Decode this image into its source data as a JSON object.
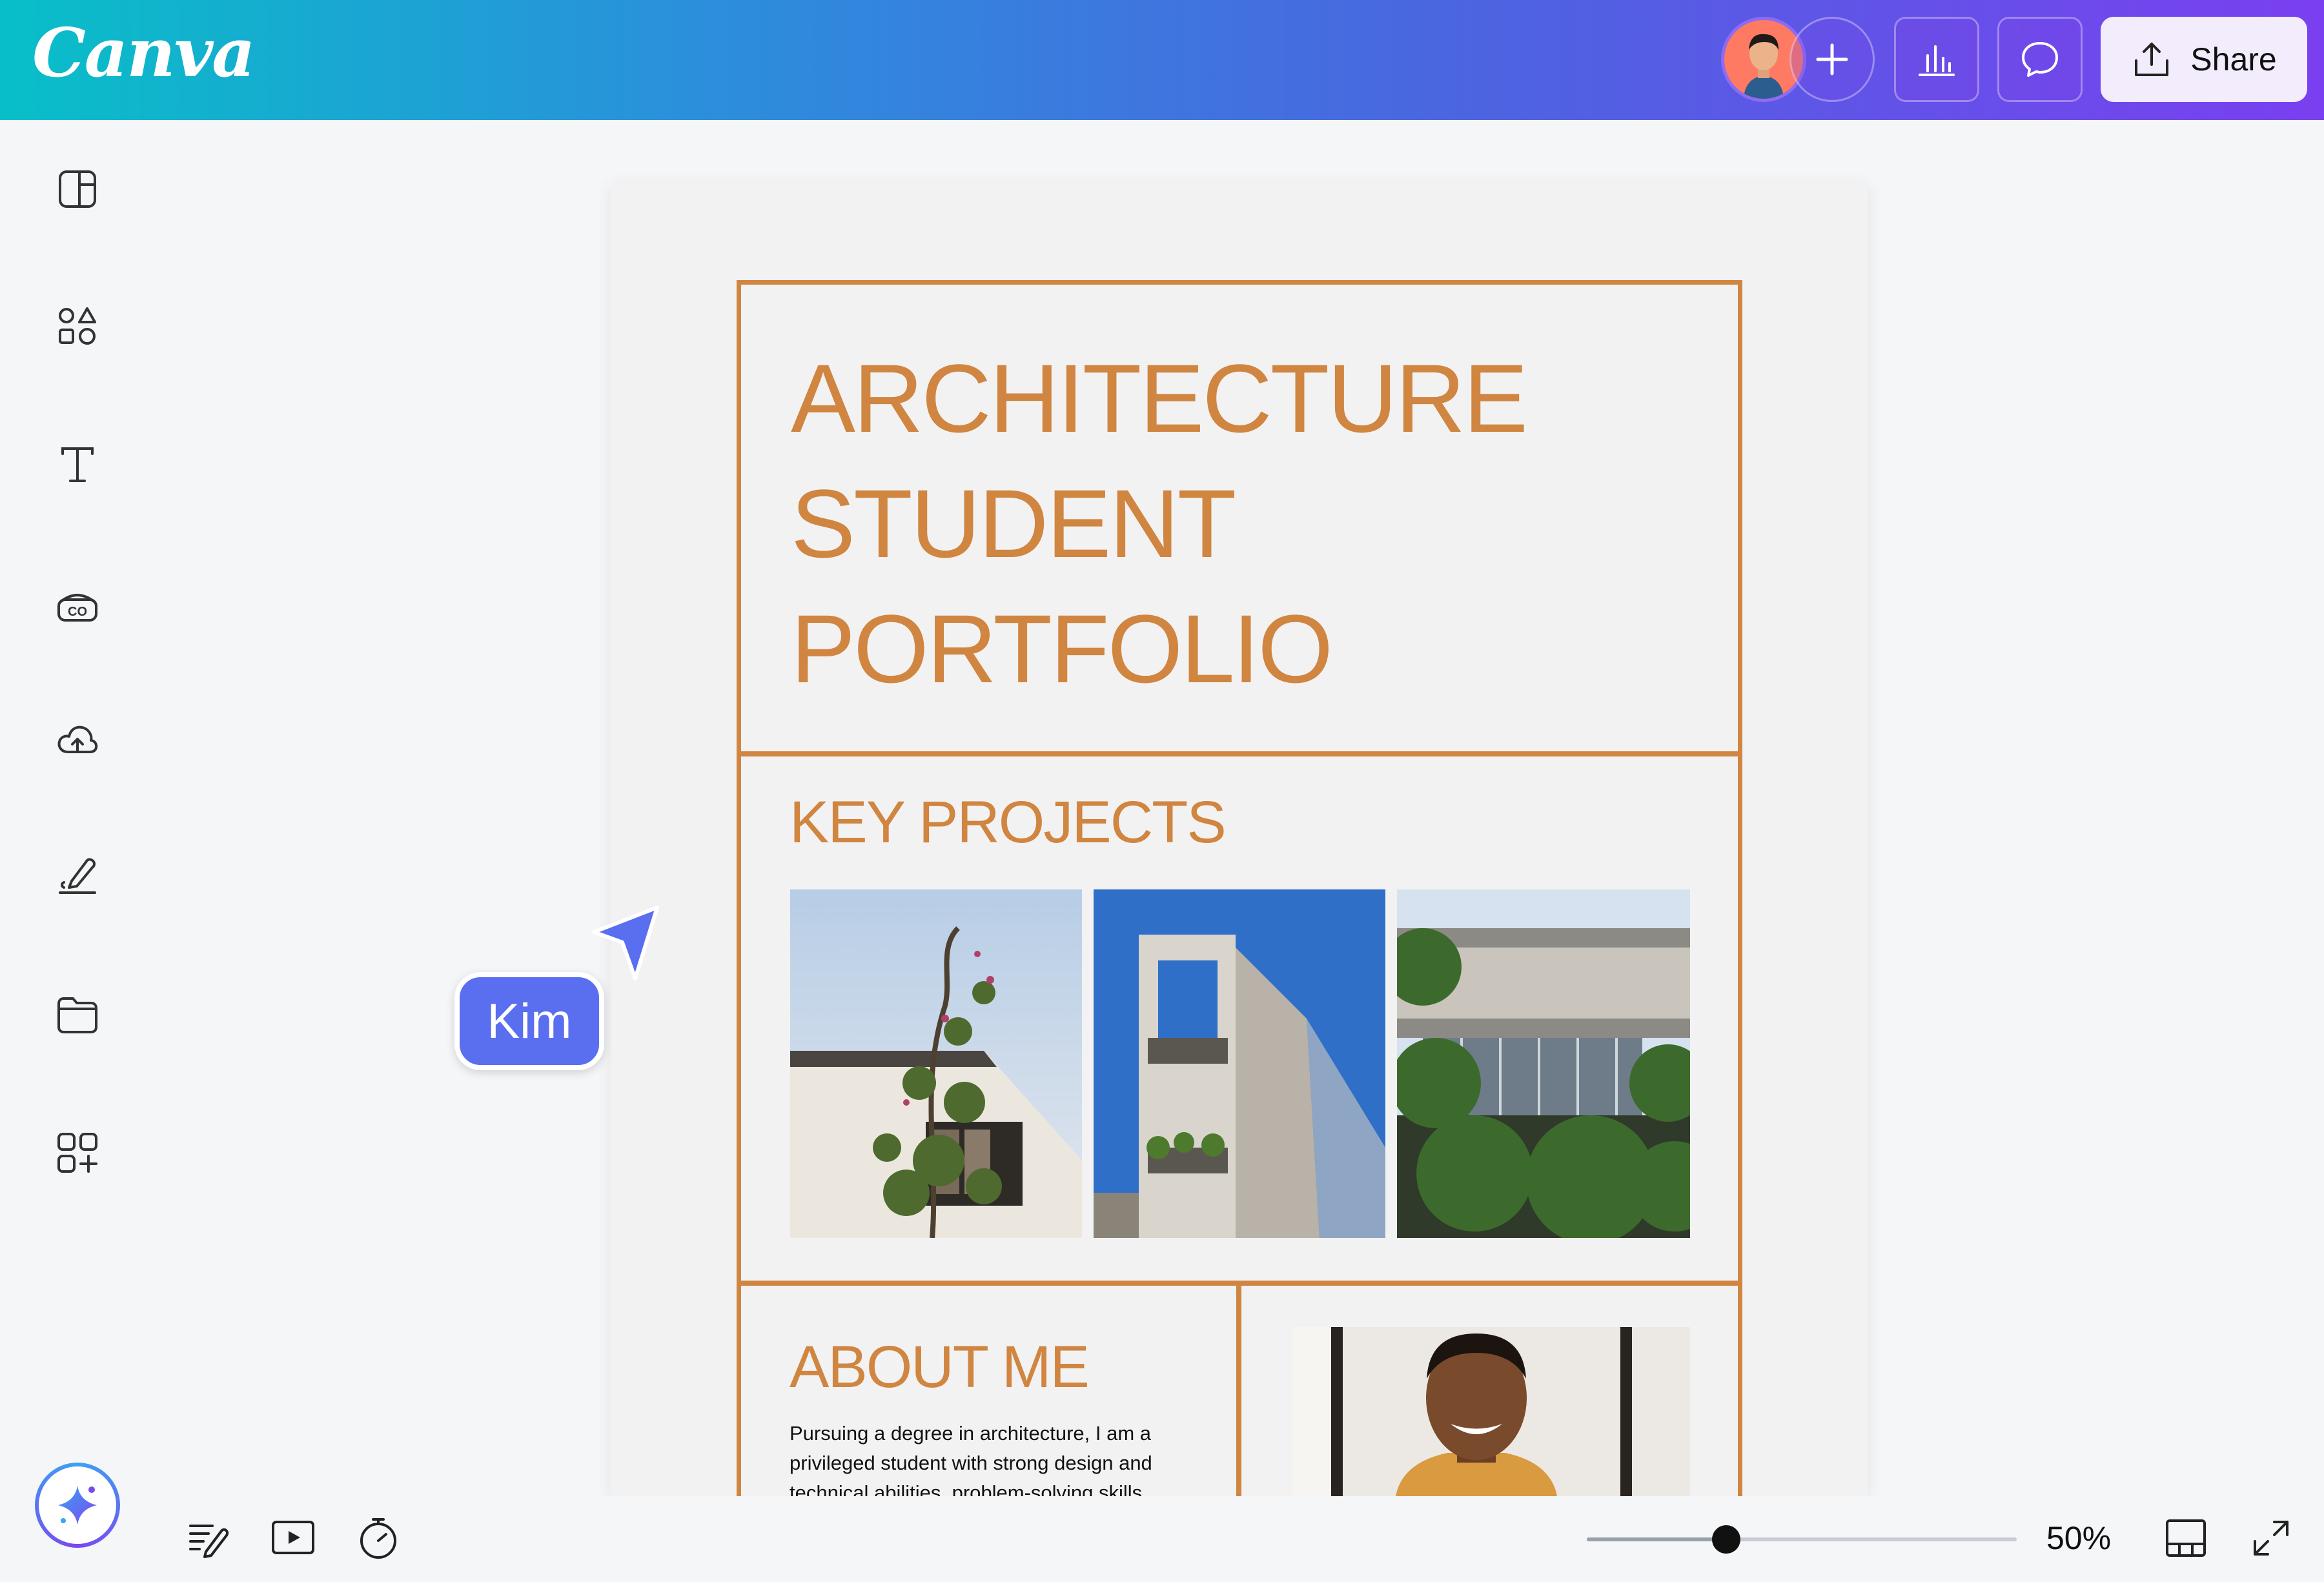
{
  "app": {
    "logo": "Canva"
  },
  "header": {
    "collaborator_avatar": "avatar",
    "share_label": "Share",
    "icons": [
      "add-icon",
      "insights-icon",
      "comment-icon",
      "share-upload-icon"
    ]
  },
  "sidebar": {
    "items": [
      {
        "name": "design",
        "icon": "layout-icon"
      },
      {
        "name": "elements",
        "icon": "shapes-icon"
      },
      {
        "name": "text",
        "icon": "text-icon"
      },
      {
        "name": "brand",
        "icon": "brand-icon"
      },
      {
        "name": "uploads",
        "icon": "cloud-upload-icon"
      },
      {
        "name": "draw",
        "icon": "draw-icon"
      },
      {
        "name": "projects",
        "icon": "folder-icon"
      },
      {
        "name": "apps",
        "icon": "apps-icon"
      }
    ],
    "magic_icon": "sparkle-icon"
  },
  "document": {
    "title_lines": [
      "ARCHITECTURE",
      "STUDENT",
      "PORTFOLIO"
    ],
    "key_projects_heading": "KEY PROJECTS",
    "about_heading": "ABOUT ME",
    "about_text": "Pursuing a degree in architecture, I am a privileged student with strong design and technical abilities, problem-solving skills",
    "accent_color": "#d08540"
  },
  "cursor": {
    "collaborator_name": "Kim",
    "color": "#5a6ef0"
  },
  "footer": {
    "zoom_label": "50%",
    "zoom_level": 0.5,
    "icons": [
      "notes-icon",
      "present-icon",
      "timer-icon",
      "grid-view-icon",
      "fullscreen-icon"
    ]
  }
}
